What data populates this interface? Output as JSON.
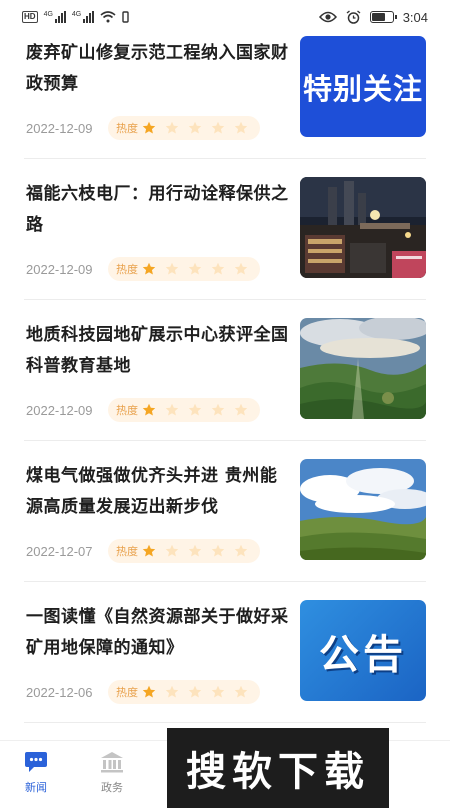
{
  "status_bar": {
    "hd_label": "HD",
    "sim1": "4G",
    "sim2": "4G",
    "time": "3:04"
  },
  "feed": {
    "heat_label": "热度",
    "items": [
      {
        "title": "废弃矿山修复示范工程纳入国家财政预算",
        "date": "2022-12-09",
        "rating": 1,
        "thumb": "special",
        "thumb_text": "特别关注"
      },
      {
        "title": "福能六枝电厂：用行动诠释保供之路",
        "date": "2022-12-09",
        "rating": 1,
        "thumb": "power-plant-night"
      },
      {
        "title": "地质科技园地矿展示中心获评全国科普教育基地",
        "date": "2022-12-09",
        "rating": 1,
        "thumb": "geopark-landscape"
      },
      {
        "title": "煤电气做强做优齐头并进 贵州能源高质量发展迈出新步伐",
        "date": "2022-12-07",
        "rating": 1,
        "thumb": "grassland-sky"
      },
      {
        "title": "一图读懂《自然资源部关于做好采矿用地保障的通知》",
        "date": "2022-12-06",
        "rating": 1,
        "thumb": "notice",
        "thumb_text": "公告"
      }
    ]
  },
  "bottom_nav": {
    "tabs": [
      {
        "label": "新闻",
        "icon": "chat-bubble-icon",
        "active": true
      },
      {
        "label": "政务",
        "icon": "government-building-icon",
        "active": false
      }
    ]
  },
  "watermark": {
    "text": "搜软下载"
  },
  "colors": {
    "accent": "#2b62d9",
    "heat": "#f5a623",
    "heat_bg": "#fff4e6",
    "thumb_blue": "#1e4fd8"
  }
}
